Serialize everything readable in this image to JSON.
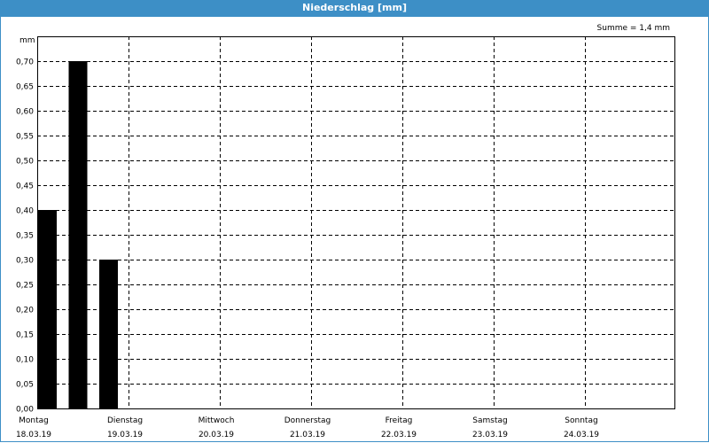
{
  "header": {
    "title": "Niederschlag [mm]"
  },
  "chart_data": {
    "type": "bar",
    "title": "Niederschlag [mm]",
    "unit_label": "mm",
    "sum_label": "Summe = 1,4 mm",
    "ylim": [
      0,
      0.75
    ],
    "y_ticks": [
      "0,00",
      "0,05",
      "0,10",
      "0,15",
      "0,20",
      "0,25",
      "0,30",
      "0,35",
      "0,40",
      "0,45",
      "0,50",
      "0,55",
      "0,60",
      "0,65",
      "0,70"
    ],
    "x_labels": [
      {
        "day": "Montag",
        "date": "18.03.19"
      },
      {
        "day": "Dienstag",
        "date": "19.03.19"
      },
      {
        "day": "Mittwoch",
        "date": "20.03.19"
      },
      {
        "day": "Donnerstag",
        "date": "21.03.19"
      },
      {
        "day": "Freitag",
        "date": "22.03.19"
      },
      {
        "day": "Samstag",
        "date": "23.03.19"
      },
      {
        "day": "Sonntag",
        "date": "24.03.19"
      }
    ],
    "bars": [
      {
        "slot": 0,
        "value": 0.4
      },
      {
        "slot": 1,
        "value": 0.7
      },
      {
        "slot": 2,
        "value": 0.3
      }
    ],
    "grid": true,
    "bar_color": "#000000"
  }
}
